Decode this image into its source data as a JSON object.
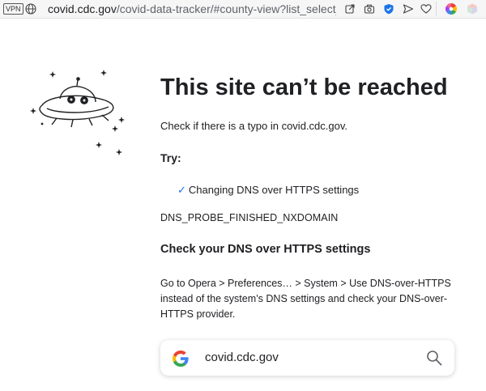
{
  "browser": {
    "vpn_label": "VPN",
    "url_host": "covid.cdc.gov",
    "url_rest": "/covid-data-tracker/#county-view?list_select_s",
    "icons": [
      "globe-icon",
      "share-icon",
      "camera-icon",
      "shield-check-icon",
      "send-icon",
      "heart-icon",
      "color-wheel-icon",
      "cube-icon"
    ]
  },
  "error_page": {
    "title": "This site can’t be reached",
    "typo_hint": "Check if there is a typo in covid.cdc.gov.",
    "try_label": "Try:",
    "suggestion": "Changing DNS over HTTPS settings",
    "error_code": "DNS_PROBE_FINISHED_NXDOMAIN",
    "dns_heading": "Check your DNS over HTTPS settings",
    "dns_body": "Go to Opera > Preferences… > System > Use DNS-over-HTTPS instead of the system’s DNS settings and check your DNS-over-HTTPS provider.",
    "search_query": "covid.cdc.gov"
  },
  "colors": {
    "accent_check": "#1a73e8",
    "shield_blue": "#1a73e8"
  }
}
